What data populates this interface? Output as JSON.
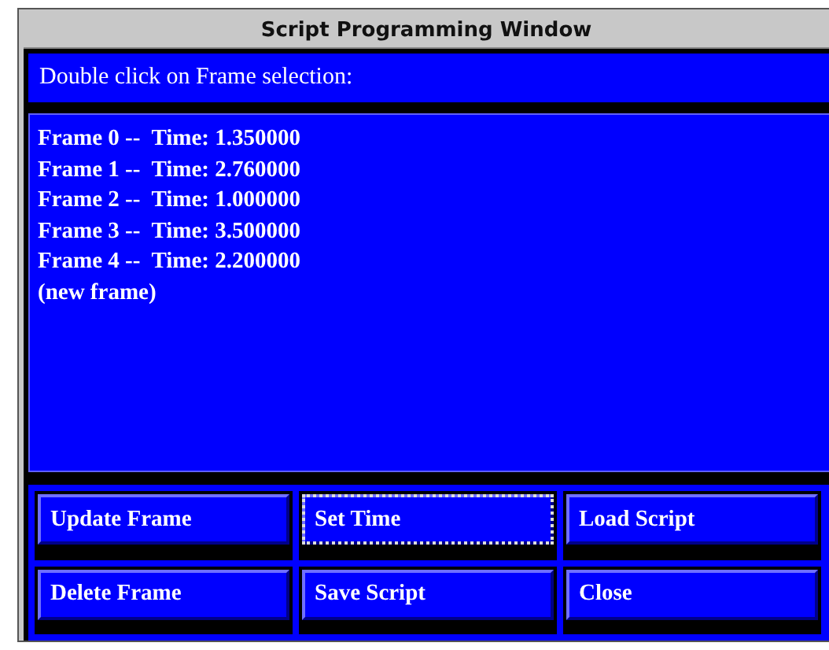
{
  "window": {
    "title": "Script Programming Window"
  },
  "prompt": "Double click on Frame selection:",
  "frames": [
    {
      "label": "Frame 0 --  Time: 1.350000"
    },
    {
      "label": "Frame 1 --  Time: 2.760000"
    },
    {
      "label": "Frame 2 --  Time: 1.000000"
    },
    {
      "label": "Frame 3 --  Time: 3.500000"
    },
    {
      "label": "Frame 4 --  Time: 2.200000"
    },
    {
      "label": "(new frame)"
    }
  ],
  "buttons": [
    {
      "label": "Update Frame",
      "focused": false
    },
    {
      "label": "Set Time",
      "focused": true
    },
    {
      "label": "Load Script",
      "focused": false
    },
    {
      "label": "Delete Frame",
      "focused": false
    },
    {
      "label": "Save Script",
      "focused": false
    },
    {
      "label": "Close",
      "focused": false
    }
  ]
}
